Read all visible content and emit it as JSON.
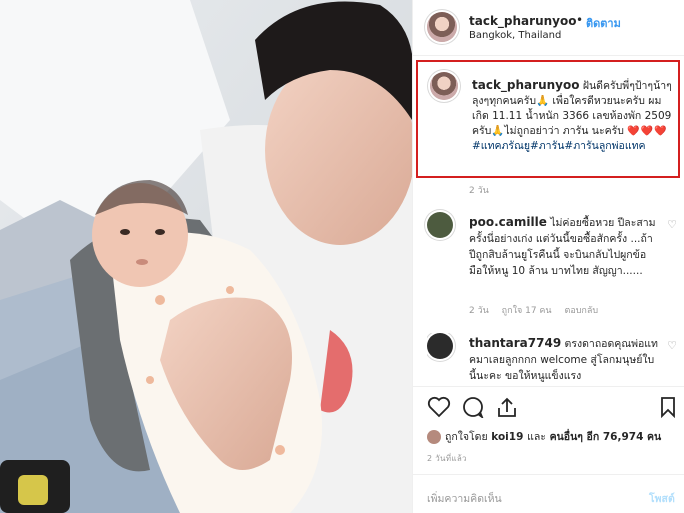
{
  "header": {
    "username": "tack_pharunyoo",
    "dot": "•",
    "follow_label": "ติดตาม",
    "location": "Bangkok, Thailand"
  },
  "caption": {
    "username": "tack_pharunyoo",
    "text": "ฝันดีครับพี่ๆป้าๆน้าๆลุงๆทุกคนครับ🙏 เพื่อใครดีหวยนะครับ ผมเกิด 11.11 น้ำหนัก 3366 เลขห้องพัก 2509 ครับ🙏ไม่ถูกอย่าว่า ภารัน นะครับ",
    "hearts": "❤️❤️❤️",
    "tags": "#แทคภรัณยู#ภารัน#ภารันลูกพ่อแทค",
    "time": "2 วัน"
  },
  "comments": [
    {
      "username": "poo.camille",
      "text": "ไม่ค่อยซื้อหวย ปีละสามครั้งนี่อย่างเก่ง แต่วันนี้ขอซื้อสักครั้ง ...ถ้าปีถูกสิบล้านยูโรคืนนี้ จะบินกลับไปผูกข้อมือให้หนู 10 ล้าน บาทไทย สัญญา......",
      "time": "2 วัน",
      "likes": "ถูกใจ 17 คน",
      "reply": "ตอบกลับ"
    },
    {
      "username": "thantara7749",
      "text": "ตรงดาถอดคุณพ่อแทคมาเลยลูกกกก welcome สู่โลกมนุษย์ใบนี้นะคะ ขอให้หนูแข็งแรง"
    }
  ],
  "likes_line": {
    "prefix": "ถูกใจโดย",
    "user": "koi19",
    "middle": "และ",
    "others": "คนอื่นๆ อีก 76,974 คน"
  },
  "post_time": "2 วันที่แล้ว",
  "add_comment": {
    "placeholder": "เพิ่มความคิดเห็น",
    "post_label": "โพสต์"
  },
  "icons": [
    "heart-icon",
    "comment-icon",
    "share-icon",
    "bookmark-icon"
  ],
  "colors": {
    "link": "#3897f0",
    "highlight_border": "#d41f1f",
    "heart": "#ed1f3b",
    "muted": "#999999"
  }
}
